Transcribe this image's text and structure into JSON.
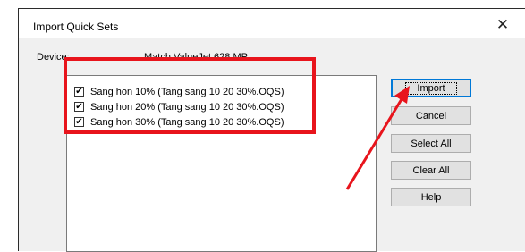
{
  "dialog": {
    "title": "Import Quick Sets",
    "close_glyph": "✕",
    "device_label": "Device:",
    "device_value": "Match ValueJet 628 MP"
  },
  "items": [
    {
      "label": "Sang hon 10% (Tang sang 10 20 30%.OQS)",
      "checked": true
    },
    {
      "label": "Sang hon 20% (Tang sang 10 20 30%.OQS)",
      "checked": true
    },
    {
      "label": "Sang hon 30% (Tang sang 10 20 30%.OQS)",
      "checked": true
    }
  ],
  "checkmark": "✔",
  "buttons": {
    "import": "Import",
    "cancel": "Cancel",
    "select_all": "Select All",
    "clear_all": "Clear All",
    "help": "Help"
  },
  "annotation_color": "#e8141c"
}
